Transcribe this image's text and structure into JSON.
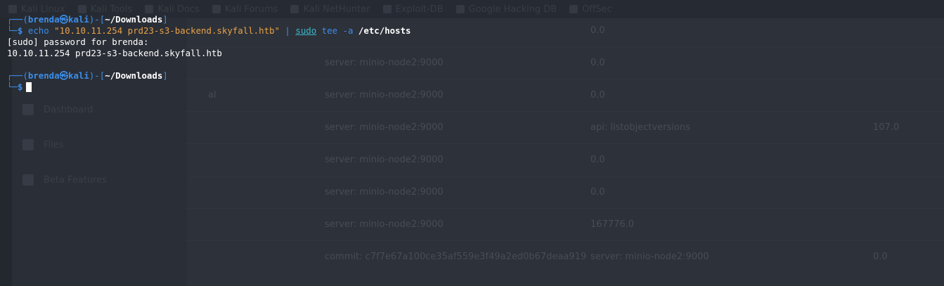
{
  "background_browser": {
    "bookmarks": [
      "Kali Linux",
      "Kali Tools",
      "Kali Docs",
      "Kali Forums",
      "Kali NetHunter",
      "Exploit-DB",
      "Google Hacking DB",
      "OffSec"
    ],
    "sidebar": [
      {
        "label": "Dashboard",
        "icon": "dashboard-icon"
      },
      {
        "label": "Files",
        "icon": "files-icon"
      },
      {
        "label": "Beta Features",
        "icon": "group-icon"
      }
    ],
    "stray_text": "al",
    "rows": [
      {
        "c1": "",
        "c2": "0.0",
        "c3": ""
      },
      {
        "c1": "server: minio-node2:9000",
        "c2": "0.0",
        "c3": ""
      },
      {
        "c1": "server: minio-node2:9000",
        "c2": "0.0",
        "c3": ""
      },
      {
        "c1": "server: minio-node2:9000",
        "c2": "api: listobjectversions",
        "c3": "107.0"
      },
      {
        "c1": "server: minio-node2:9000",
        "c2": "0.0",
        "c3": ""
      },
      {
        "c1": "server: minio-node2:9000",
        "c2": "0.0",
        "c3": ""
      },
      {
        "c1": "server: minio-node2:9000",
        "c2": "167776.0",
        "c3": ""
      },
      {
        "c1": "commit: c7f7e67a100ce35af559e3f49a2ed0b67deaa919",
        "c2": "server: minio-node2:9000",
        "c3": "0.0"
      }
    ]
  },
  "terminal": {
    "user": "brenda",
    "host": "kali",
    "cwd": "~/Downloads",
    "prompt_symbol": "$",
    "command": {
      "echo": "echo",
      "string": "\"10.10.11.254 prd23-s3-backend.skyfall.htb\"",
      "pipe": "|",
      "sudo": "sudo",
      "tee": "tee",
      "flag": "-a",
      "file": "/etc/hosts"
    },
    "output": [
      "[sudo] password for brenda:",
      "10.10.11.254 prd23-s3-backend.skyfall.htb"
    ]
  },
  "colors": {
    "background": "#22262e",
    "prompt_blue": "#3b8eea",
    "string_orange": "#e8a248",
    "sudo_cyan": "#3bb8c9"
  }
}
